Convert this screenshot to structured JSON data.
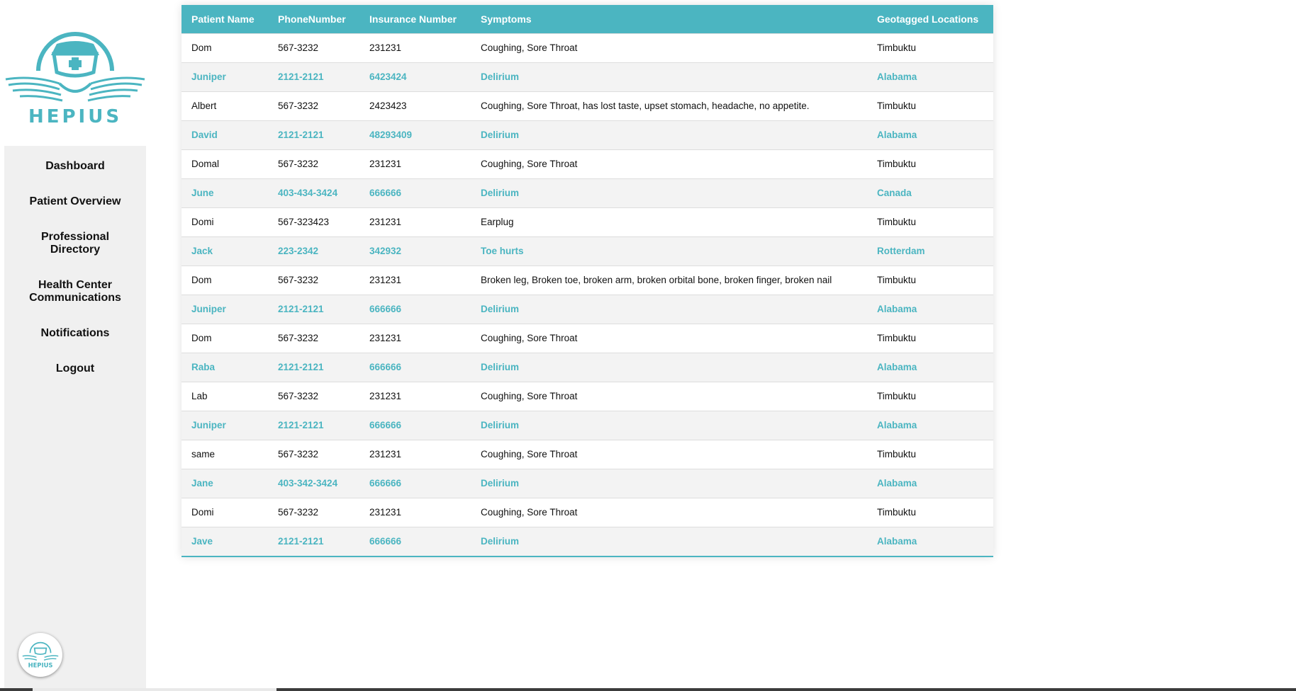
{
  "brand": {
    "name": "HEPIUS",
    "accent": "#4bb5c1"
  },
  "sidebar": {
    "items": [
      {
        "label": "Dashboard"
      },
      {
        "label": "Patient Overview"
      },
      {
        "label": "Professional Directory"
      },
      {
        "label": "Health Center Communications"
      },
      {
        "label": "Notifications"
      },
      {
        "label": "Logout"
      }
    ]
  },
  "table": {
    "headers": [
      "Patient Name",
      "PhoneNumber",
      "Insurance Number",
      "Symptoms",
      "Geotagged Locations"
    ],
    "rows": [
      [
        "Dom",
        "567-3232",
        "231231",
        "Coughing, Sore Throat",
        "Timbuktu"
      ],
      [
        "Juniper",
        "2121-2121",
        "6423424",
        "Delirium",
        "Alabama"
      ],
      [
        "Albert",
        "567-3232",
        "2423423",
        "Coughing, Sore Throat, has lost taste, upset stomach, headache, no appetite.",
        "Timbuktu"
      ],
      [
        "David",
        "2121-2121",
        "48293409",
        "Delirium",
        "Alabama"
      ],
      [
        "Domal",
        "567-3232",
        "231231",
        "Coughing, Sore Throat",
        "Timbuktu"
      ],
      [
        "June",
        "403-434-3424",
        "666666",
        "Delirium",
        "Canada"
      ],
      [
        "Domi",
        "567-323423",
        "231231",
        "Earplug",
        "Timbuktu"
      ],
      [
        "Jack",
        "223-2342",
        "342932",
        "Toe hurts",
        "Rotterdam"
      ],
      [
        "Dom",
        "567-3232",
        "231231",
        "Broken leg, Broken toe, broken arm, broken orbital bone, broken finger, broken nail",
        "Timbuktu"
      ],
      [
        "Juniper",
        "2121-2121",
        "666666",
        "Delirium",
        "Alabama"
      ],
      [
        "Dom",
        "567-3232",
        "231231",
        "Coughing, Sore Throat",
        "Timbuktu"
      ],
      [
        "Raba",
        "2121-2121",
        "666666",
        "Delirium",
        "Alabama"
      ],
      [
        "Lab",
        "567-3232",
        "231231",
        "Coughing, Sore Throat",
        "Timbuktu"
      ],
      [
        "Juniper",
        "2121-2121",
        "666666",
        "Delirium",
        "Alabama"
      ],
      [
        "same",
        "567-3232",
        "231231",
        "Coughing, Sore Throat",
        "Timbuktu"
      ],
      [
        "Jane",
        "403-342-3424",
        "666666",
        "Delirium",
        "Alabama"
      ],
      [
        "Domi",
        "567-3232",
        "231231",
        "Coughing, Sore Throat",
        "Timbuktu"
      ],
      [
        "Jave",
        "2121-2121",
        "666666",
        "Delirium",
        "Alabama"
      ]
    ]
  }
}
